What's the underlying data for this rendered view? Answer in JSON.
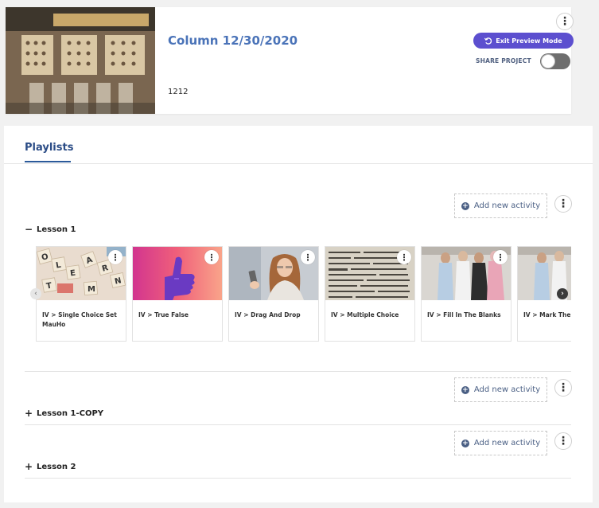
{
  "project": {
    "title": "Column 12/30/2020",
    "description": "1212",
    "exit_preview_label": "Exit Preview Mode",
    "share_label": "SHARE PROJECT",
    "share_enabled": false
  },
  "tabs": {
    "playlists_label": "Playlists"
  },
  "add_activity_label": "Add new activity",
  "lessons": [
    {
      "sign": "−",
      "title": "Lesson 1"
    },
    {
      "sign": "+",
      "title": "Lesson 1-COPY"
    },
    {
      "sign": "+",
      "title": "Lesson 2"
    }
  ],
  "activities": [
    {
      "label": "IV > Single Choice Set MauHo",
      "icon": "scrabble-tiles-image"
    },
    {
      "label": "IV > True False",
      "icon": "thumbs-up-image"
    },
    {
      "label": "IV > Drag And Drop",
      "icon": "woman-phone-image"
    },
    {
      "label": "IV > Multiple Choice",
      "icon": "dictionary-image"
    },
    {
      "label": "IV > Fill In The Blanks",
      "icon": "friends-image"
    },
    {
      "label": "IV > Mark The",
      "icon": "friends-image"
    }
  ],
  "colors": {
    "accent": "#5c4fcf",
    "title": "#4a73b8",
    "tab": "#2b4c86"
  }
}
